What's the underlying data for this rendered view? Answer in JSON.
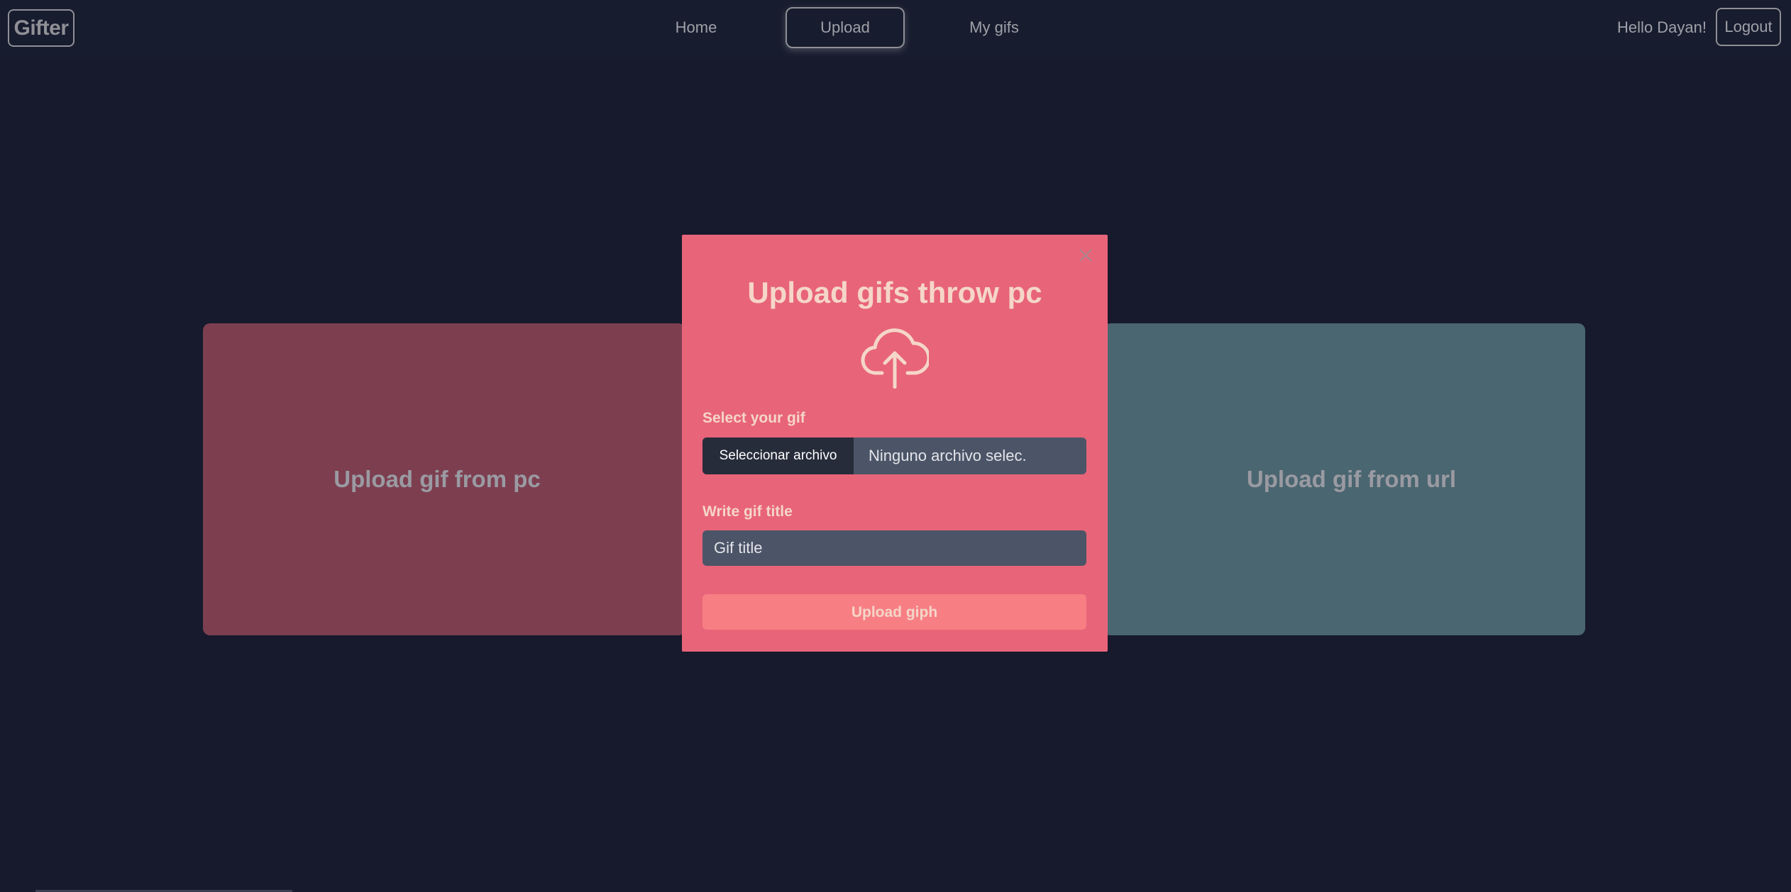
{
  "navbar": {
    "logo": "Gifter",
    "links": [
      "Home",
      "Upload",
      "My gifs"
    ],
    "greeting": "Hello Dayan!",
    "logout": "Logout"
  },
  "cards": {
    "pc": "Upload gif from pc",
    "url": "Upload gif from url"
  },
  "modal": {
    "title": "Upload gifs throw pc",
    "icon": "cloud-upload-icon",
    "select_label": "Select your gif",
    "file_button": "Seleccionar archivo",
    "file_status": "Ninguno archivo selec.",
    "title_label": "Write gif title",
    "title_placeholder": "Gif title",
    "submit": "Upload giph"
  },
  "colors": {
    "background": "#161a2c",
    "modal": "#e86479",
    "card_pc": "#7d3f50",
    "card_url": "#4a6670",
    "accent_text": "#f5d6c8",
    "submit_button": "#f77f84"
  }
}
